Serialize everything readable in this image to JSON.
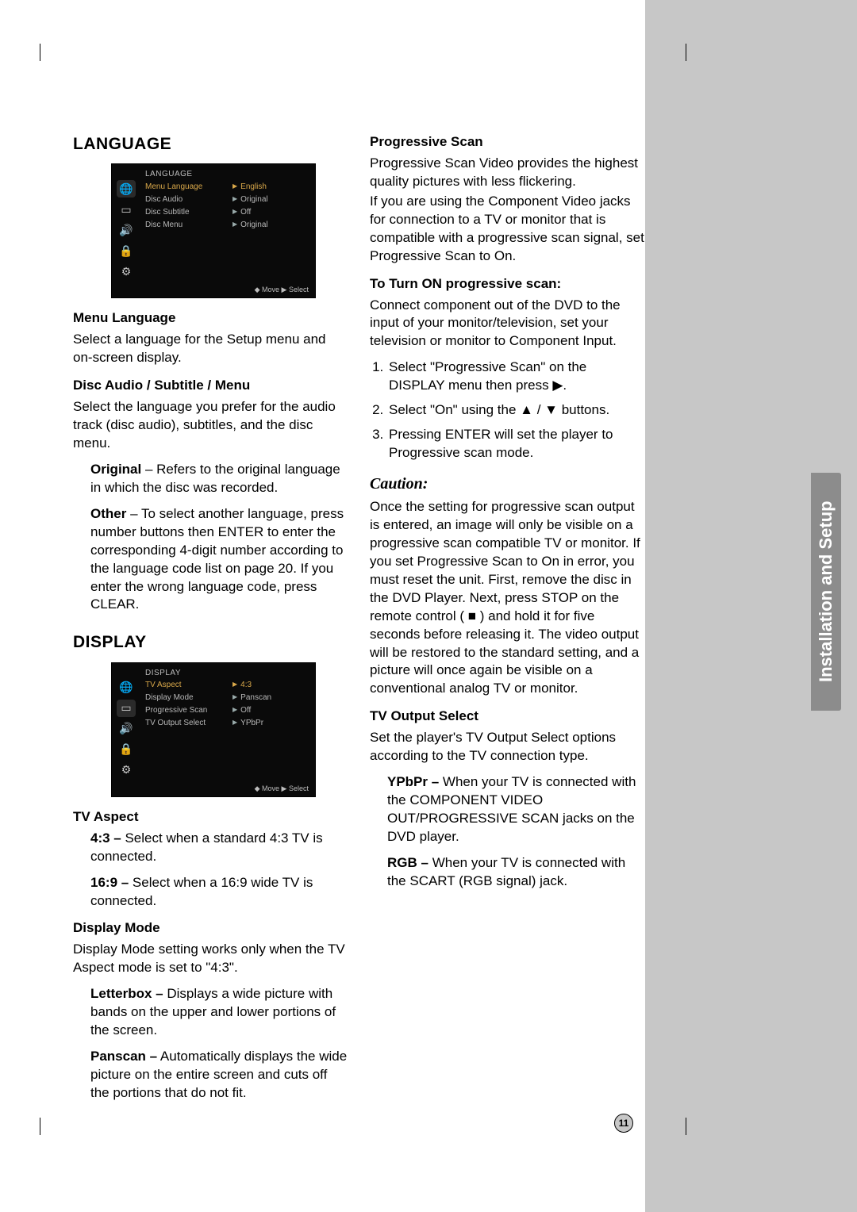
{
  "sideTab": "Installation and Setup",
  "pageNumber": "11",
  "left": {
    "h_language": "LANGUAGE",
    "osd1": {
      "title": "LANGUAGE",
      "rows": [
        {
          "label": "Menu Language",
          "val": "English",
          "hl": true
        },
        {
          "label": "Disc Audio",
          "val": "Original"
        },
        {
          "label": "Disc Subtitle",
          "val": "Off"
        },
        {
          "label": "Disc Menu",
          "val": "Original"
        }
      ],
      "footer": "◆ Move ▶ Select"
    },
    "sub_menuLang": "Menu Language",
    "p_menuLang": "Select a language for the Setup menu and on-screen display.",
    "sub_discAudio": "Disc Audio / Subtitle / Menu",
    "p_discAudio": "Select the language you prefer for the audio track (disc audio), subtitles, and the disc menu.",
    "p_original_b": "Original",
    "p_original": " – Refers to the original language in which the disc was recorded.",
    "p_other_b": "Other",
    "p_other": " – To select another language, press number buttons then ENTER to enter the corresponding 4-digit number according to the language code list on page 20. If you enter the wrong language code, press CLEAR.",
    "h_display": "DISPLAY",
    "osd2": {
      "title": "DISPLAY",
      "rows": [
        {
          "label": "TV Aspect",
          "val": "4:3",
          "hl": true
        },
        {
          "label": "Display Mode",
          "val": "Panscan"
        },
        {
          "label": "Progressive Scan",
          "val": "Off"
        },
        {
          "label": "TV Output Select",
          "val": "YPbPr"
        }
      ],
      "footer": "◆ Move ▶ Select"
    },
    "sub_tvAspect": "TV Aspect",
    "p_43_b": "4:3 –",
    "p_43": " Select when a standard 4:3 TV is connected.",
    "p_169_b": "16:9 –",
    "p_169": " Select when a 16:9 wide TV is connected.",
    "sub_displayMode": "Display Mode",
    "p_displayMode": "Display Mode setting works only when the TV Aspect mode is set to \"4:3\".",
    "p_letterbox_b": "Letterbox –",
    "p_letterbox": " Displays a wide picture with bands on the upper and lower portions of the screen.",
    "p_panscan_b": "Panscan –",
    "p_panscan": " Automatically displays the wide picture on the entire screen and cuts off the portions that do not fit."
  },
  "right": {
    "sub_progScan": "Progressive Scan",
    "p_prog1": "Progressive Scan Video provides the highest quality pictures with less flickering.",
    "p_prog2": "If you are using the Component Video jacks for connection to a TV or monitor that is compatible with a progressive scan signal, set Progressive Scan to On.",
    "sub_turnOn": "To Turn ON progressive scan:",
    "p_turnOn": "Connect component out of the DVD to the input of your monitor/television, set your television or monitor to Component Input.",
    "ol1": "Select \"Progressive Scan\" on the DISPLAY menu then press ▶.",
    "ol2": "Select \"On\" using the ▲ / ▼ buttons.",
    "ol3": "Pressing ENTER will set the player to Progressive scan mode.",
    "caution_h": "Caution:",
    "p_caution": "Once the setting for progressive scan output is entered, an image will only be visible on a progressive scan compatible TV or monitor. If you set Progressive Scan to On in error, you must reset the unit. First, remove the disc in the DVD Player. Next, press STOP on the remote control ( ■ ) and hold it for five seconds before releasing it. The video output will be restored to the standard setting, and a picture will once again be visible on a conventional analog TV or monitor.",
    "sub_tvOut": "TV Output Select",
    "p_tvOut": "Set the player's TV Output Select options according to the TV connection type.",
    "p_ypbpr_b": "YPbPr –",
    "p_ypbpr": " When your TV is connected with the COMPONENT VIDEO OUT/PROGRESSIVE SCAN jacks on the DVD player.",
    "p_rgb_b": "RGB –",
    "p_rgb": " When your TV is connected with the SCART (RGB signal) jack."
  }
}
